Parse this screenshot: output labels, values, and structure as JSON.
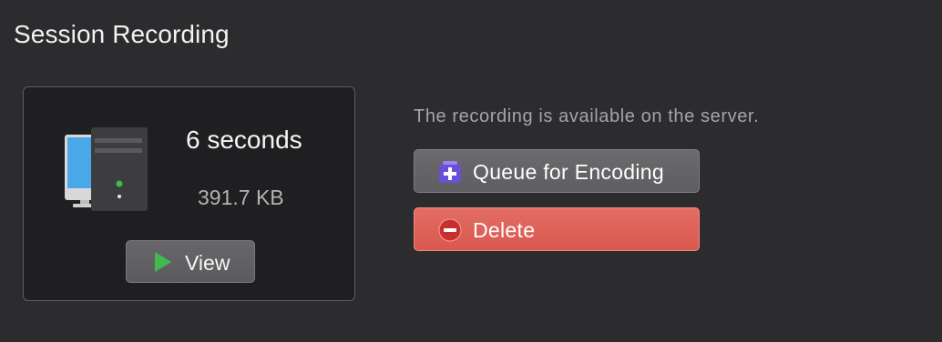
{
  "header": {
    "title": "Session Recording"
  },
  "recording": {
    "duration": "6 seconds",
    "size": "391.7 KB",
    "view_label": "View"
  },
  "actions": {
    "status_text": "The recording is available on the server.",
    "queue_label": "Queue for Encoding",
    "delete_label": "Delete"
  },
  "icons": {
    "computer": "computer-tower-icon",
    "play": "play-icon",
    "queue": "queue-add-icon",
    "delete": "delete-minus-icon"
  },
  "colors": {
    "background": "#2c2c2e",
    "card": "#1f1f21",
    "play_green": "#3fb950",
    "delete_red": "#e0655c",
    "queue_purple": "#6b4fd8"
  }
}
